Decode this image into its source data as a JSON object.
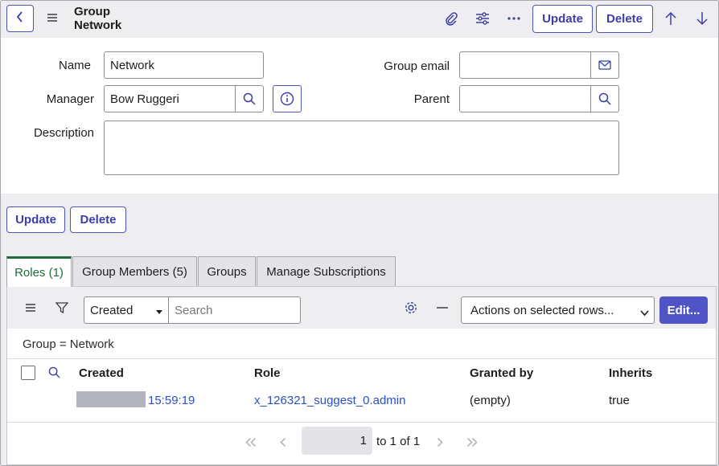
{
  "header": {
    "title": "Group Network",
    "update_label": "Update",
    "delete_label": "Delete",
    "icons": [
      "back-icon",
      "hamburger-icon",
      "paperclip-icon",
      "sliders-icon",
      "more-icon",
      "arrow-up-icon",
      "arrow-down-icon"
    ]
  },
  "form": {
    "name_label": "Name",
    "name_value": "Network",
    "manager_label": "Manager",
    "manager_value": "Bow Ruggeri",
    "description_label": "Description",
    "description_value": "",
    "group_email_label": "Group email",
    "group_email_value": "",
    "parent_label": "Parent",
    "parent_value": ""
  },
  "actions": {
    "update_label": "Update",
    "delete_label": "Delete"
  },
  "tabs": [
    {
      "label": "Roles (1)",
      "active": true
    },
    {
      "label": "Group Members (5)",
      "active": false
    },
    {
      "label": "Groups",
      "active": false
    },
    {
      "label": "Manage Subscriptions",
      "active": false
    }
  ],
  "list": {
    "filter_field": "Created",
    "search_placeholder": "Search",
    "actions_select": "Actions on selected rows...",
    "edit_label": "Edit...",
    "breadcrumb": "Group = Network",
    "columns": [
      "Created",
      "Role",
      "Granted by",
      "Inherits"
    ],
    "rows": [
      {
        "created_time": "15:59:19",
        "role": "x_126321_suggest_0.admin",
        "granted_by": "(empty)",
        "inherits": "true"
      }
    ],
    "pager": {
      "current": "1",
      "range_text": "to 1 of 1"
    }
  },
  "colors": {
    "accent": "#3c3ea7",
    "edit_button": "#5054c4",
    "active_tab": "#1f6b3d",
    "link": "#2b4fc4"
  }
}
